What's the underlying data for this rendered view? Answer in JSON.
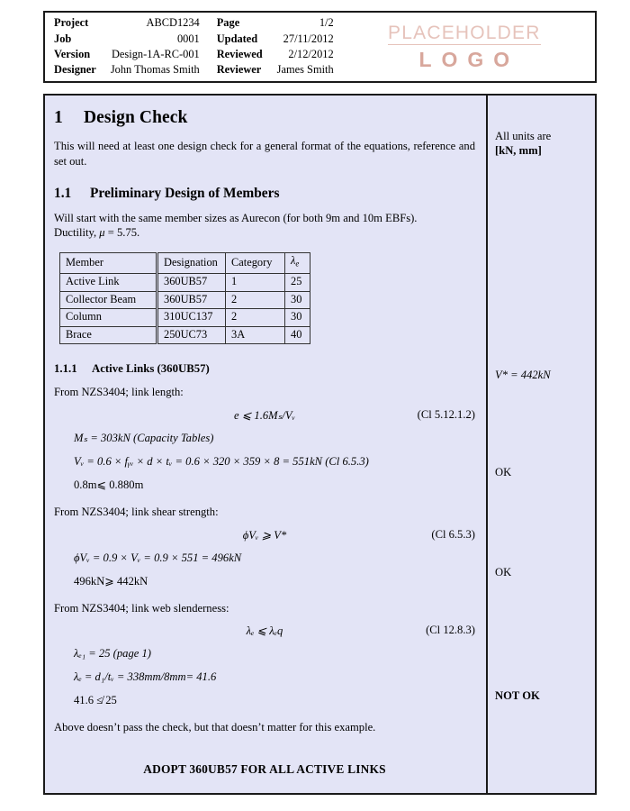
{
  "header": {
    "left_rows": [
      {
        "key": "Project",
        "value": "ABCD1234"
      },
      {
        "key": "Job",
        "value": "0001"
      },
      {
        "key": "Version",
        "value": "Design-1A-RC-001"
      },
      {
        "key": "Designer",
        "value": "John Thomas Smith"
      }
    ],
    "right_rows": [
      {
        "key": "Page",
        "value": "1/2"
      },
      {
        "key": "Updated",
        "value": "27/11/2012"
      },
      {
        "key": "Reviewed",
        "value": "2/12/2012"
      },
      {
        "key": "Reviewer",
        "value": "James Smith"
      }
    ],
    "logo": {
      "top_text": "PLACEHOLDER",
      "bottom_text": "LOGO",
      "top_color": "#e6c3bb",
      "bottom_color": "#d8a79c"
    }
  },
  "document": {
    "section": {
      "number": "1",
      "title": "Design Check"
    },
    "section_intro": "This will need at least one design check for a general format of the equations, reference and set out.",
    "subsection": {
      "number": "1.1",
      "title": "Preliminary Design of Members"
    },
    "subsection_intro_line1": "Will start with the same member sizes as Aurecon (for both 9m and 10m EBFs).",
    "subsection_intro_line2_pre": "Ductility, ",
    "subsection_intro_line2_post": " = 5.75.",
    "table": {
      "headers": [
        "Member",
        "Designation",
        "Category",
        "λ"
      ],
      "header_lambda_sub": "e",
      "rows": [
        {
          "member": "Active Link",
          "designation": "360UB57",
          "category": "1",
          "lambda": "25"
        },
        {
          "member": "Collector Beam",
          "designation": "360UB57",
          "category": "2",
          "lambda": "30"
        },
        {
          "member": "Column",
          "designation": "310UC137",
          "category": "2",
          "lambda": "30"
        },
        {
          "member": "Brace",
          "designation": "250UC73",
          "category": "3A",
          "lambda": "40"
        }
      ]
    },
    "subsubsection": {
      "number": "1.1.1",
      "title": "Active Links (360UB57)"
    },
    "check_length": {
      "lead": "From NZS3404; link length:",
      "equation": "e ⩽ 1.6Mₛ/Vᵥ",
      "reference": "(Cl 5.12.1.2)",
      "line_ms": "Mₛ = 303kN (Capacity Tables)",
      "line_vv": "Vᵥ = 0.6 × fᵧᵥ × d × tᵥ = 0.6 × 320 × 359 × 8 = 551kN (Cl 6.5.3)",
      "result": "0.8m⩽ 0.880m"
    },
    "check_shear": {
      "lead": "From NZS3404; link shear strength:",
      "equation": "ϕVᵥ ⩾ V*",
      "reference": "(Cl 6.5.3)",
      "line_calc": "ϕVᵥ = 0.9 × Vᵥ = 0.9 × 551 = 496kN",
      "result": "496kN⩾ 442kN"
    },
    "check_slenderness": {
      "lead": "From NZS3404; link web slenderness:",
      "equation": "λₑ ⩽ λₑq",
      "reference": "(Cl 12.8.3)",
      "line_le1": "λₑ₁ = 25 (page 1)",
      "line_le": "λₑ = d₁/tᵥ = 338mm/8mm= 41.6",
      "result": "41.6 ≰ 25"
    },
    "closing_note": "Above doesn’t pass the check, but that doesn’t matter for this example.",
    "adopt_statement": "ADOPT 360UB57 FOR ALL ACTIVE LINKS"
  },
  "margin_notes": {
    "units_line1": "All units are",
    "units_line2": "[kN, mm]",
    "vstar": "V* = 442kN",
    "ok_shear_length": "OK",
    "ok_shear_strength": "OK",
    "not_ok_slenderness": "NOT OK"
  }
}
